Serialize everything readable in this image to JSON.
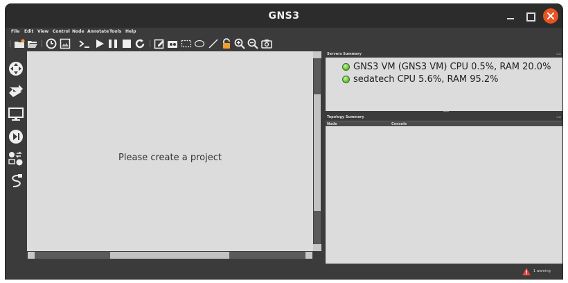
{
  "window": {
    "title": "GNS3"
  },
  "menu": [
    "File",
    "Edit",
    "View",
    "Control",
    "Node",
    "Annotate",
    "Tools",
    "Help"
  ],
  "toolbar": [
    "new-project-icon",
    "open-project-icon",
    "snapshot-clock-icon",
    "screenshot-icon",
    "console-icon",
    "start-icon",
    "pause-icon",
    "stop-icon",
    "reload-icon",
    "add-note-icon",
    "insert-image-icon",
    "draw-rectangle-icon",
    "draw-ellipse-icon",
    "draw-line-icon",
    "lock-icon",
    "zoom-in-icon",
    "zoom-out-icon",
    "take-screenshot-icon"
  ],
  "devices": [
    "routers-icon",
    "switches-icon",
    "end-devices-icon",
    "security-devices-icon",
    "all-devices-icon",
    "add-link-icon"
  ],
  "canvas": {
    "message": "Please create a project"
  },
  "servers": {
    "title": "Servers Summary",
    "items": [
      {
        "text": "GNS3 VM (GNS3 VM) CPU 0.5%, RAM 20.0%"
      },
      {
        "text": "sedatech CPU 5.6%, RAM 95.2%"
      }
    ]
  },
  "topology": {
    "title": "Topology Summary",
    "columns": [
      "Node",
      "Console"
    ]
  },
  "status": {
    "warning": "1 warning"
  },
  "colors": {
    "close_button": "#e95420",
    "accent_orange": "#f0a030",
    "status_green": "#7fd04c"
  }
}
